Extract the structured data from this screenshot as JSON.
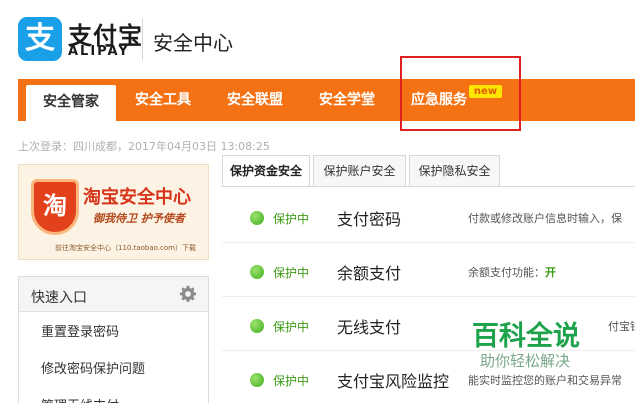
{
  "header": {
    "logo_glyph": "支",
    "logo_cn": "支付宝",
    "logo_en": "ALIPAY",
    "title": "安全中心"
  },
  "nav": {
    "items": [
      {
        "label": "安全管家"
      },
      {
        "label": "安全工具"
      },
      {
        "label": "安全联盟"
      },
      {
        "label": "安全学堂"
      },
      {
        "label": "应急服务"
      }
    ],
    "new_badge": "new"
  },
  "last_login": "上次登录：四川成都，2017年04月03日 13:08:25",
  "sidebar": {
    "banner": {
      "shield_glyph": "淘",
      "title": "淘宝安全中心",
      "slogan": "御我侍卫  护予使者",
      "link": "前往淘宝安全中心（110.taobao.com）下载"
    },
    "quick": {
      "title": "快速入口",
      "links": [
        "重置登录密码",
        "修改密码保护问题",
        "管理无线支付"
      ]
    }
  },
  "tabs": [
    "保护资金安全",
    "保护账户安全",
    "保护隐私安全"
  ],
  "rows": [
    {
      "status": "保护中",
      "feature": "支付密码",
      "desc": "付款或修改账户信息时输入，保"
    },
    {
      "status": "保护中",
      "feature": "余额支付",
      "desc": "余额支付功能：",
      "desc_state": "开"
    },
    {
      "status": "保护中",
      "feature": "无线支付",
      "desc": "付宝钱"
    },
    {
      "status": "保护中",
      "feature": "支付宝风险监控",
      "desc": "能实时监控您的账户和交易异常"
    }
  ],
  "watermark": {
    "title": "百科全说",
    "subtitle": "助你轻松解决"
  },
  "colors": {
    "brand_orange": "#f47214",
    "alipay_blue": "#1aa0e8",
    "status_green": "#3c9a14",
    "highlight_red": "#e02020"
  }
}
